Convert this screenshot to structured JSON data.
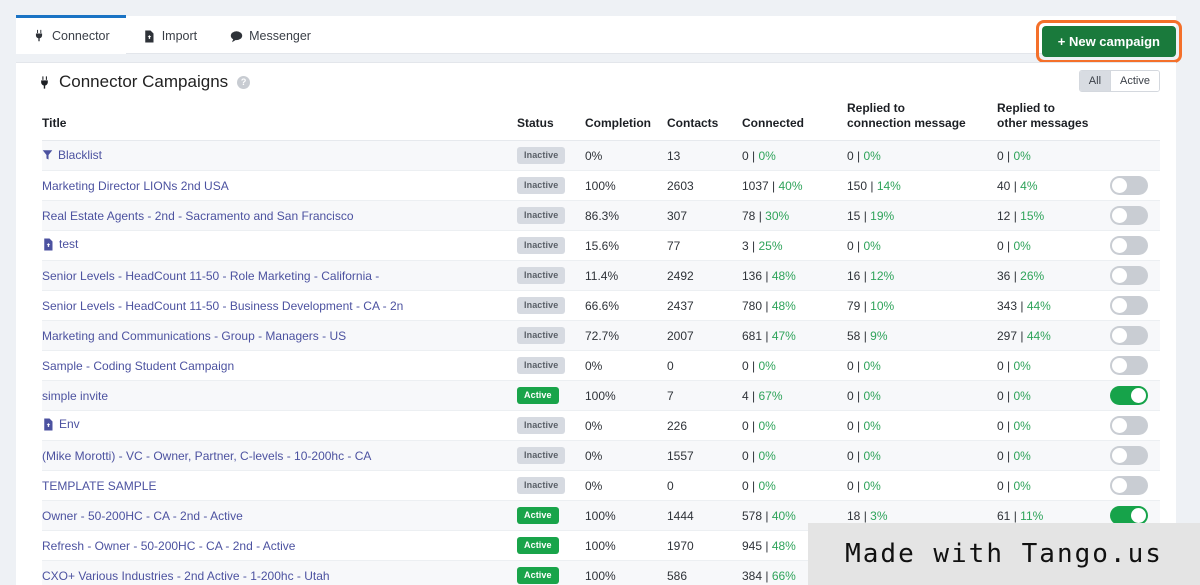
{
  "tabs": [
    {
      "label": "Connector",
      "icon": "plug-icon",
      "active": true
    },
    {
      "label": "Import",
      "icon": "file-import-icon",
      "active": false
    },
    {
      "label": "Messenger",
      "icon": "chat-bubble-icon",
      "active": false
    }
  ],
  "toolbar": {
    "new_campaign_label": "+ New campaign",
    "new_campaign_color": "#1a7a3c",
    "highlight_color": "#f4702a"
  },
  "panel": {
    "title": "Connector Campaigns",
    "title_icon": "plug-icon",
    "help_icon": "question-mark-icon",
    "help_glyph": "?",
    "filters": [
      {
        "label": "All",
        "selected": true
      },
      {
        "label": "Active",
        "selected": false
      }
    ]
  },
  "table": {
    "columns": [
      {
        "key": "title",
        "label": "Title"
      },
      {
        "key": "status",
        "label": "Status"
      },
      {
        "key": "completion",
        "label": "Completion"
      },
      {
        "key": "contacts",
        "label": "Contacts"
      },
      {
        "key": "connected",
        "label": "Connected"
      },
      {
        "key": "replied_connection",
        "label": "Replied to\nconnection message",
        "line1": "Replied to",
        "line2": "connection message"
      },
      {
        "key": "replied_other",
        "label": "Replied to\nother messages",
        "line1": "Replied to",
        "line2": "other messages"
      },
      {
        "key": "toggle",
        "label": ""
      }
    ],
    "rows": [
      {
        "title": "Blacklist",
        "icon": "funnel-icon",
        "status": "Inactive",
        "completion": "0%",
        "contacts": "13",
        "connected_n": "0",
        "connected_pct": "0%",
        "rcm_n": "0",
        "rcm_pct": "0%",
        "rom_n": "0",
        "rom_pct": "0%",
        "toggle": "none"
      },
      {
        "title": "Marketing Director LIONs 2nd USA",
        "icon": "",
        "status": "Inactive",
        "completion": "100%",
        "contacts": "2603",
        "connected_n": "1037",
        "connected_pct": "40%",
        "rcm_n": "150",
        "rcm_pct": "14%",
        "rom_n": "40",
        "rom_pct": "4%",
        "toggle": "off"
      },
      {
        "title": "Real Estate Agents - 2nd - Sacramento and San Francisco",
        "icon": "",
        "status": "Inactive",
        "completion": "86.3%",
        "contacts": "307",
        "connected_n": "78",
        "connected_pct": "30%",
        "rcm_n": "15",
        "rcm_pct": "19%",
        "rom_n": "12",
        "rom_pct": "15%",
        "toggle": "off"
      },
      {
        "title": "test",
        "icon": "file-import-icon",
        "status": "Inactive",
        "completion": "15.6%",
        "contacts": "77",
        "connected_n": "3",
        "connected_pct": "25%",
        "rcm_n": "0",
        "rcm_pct": "0%",
        "rom_n": "0",
        "rom_pct": "0%",
        "toggle": "off"
      },
      {
        "title": "Senior Levels - HeadCount 11-50 - Role Marketing - California -",
        "icon": "",
        "status": "Inactive",
        "completion": "11.4%",
        "contacts": "2492",
        "connected_n": "136",
        "connected_pct": "48%",
        "rcm_n": "16",
        "rcm_pct": "12%",
        "rom_n": "36",
        "rom_pct": "26%",
        "toggle": "off"
      },
      {
        "title": "Senior Levels - HeadCount 11-50 - Business Development - CA - 2n",
        "icon": "",
        "status": "Inactive",
        "completion": "66.6%",
        "contacts": "2437",
        "connected_n": "780",
        "connected_pct": "48%",
        "rcm_n": "79",
        "rcm_pct": "10%",
        "rom_n": "343",
        "rom_pct": "44%",
        "toggle": "off"
      },
      {
        "title": "Marketing and Communications - Group - Managers - US",
        "icon": "",
        "status": "Inactive",
        "completion": "72.7%",
        "contacts": "2007",
        "connected_n": "681",
        "connected_pct": "47%",
        "rcm_n": "58",
        "rcm_pct": "9%",
        "rom_n": "297",
        "rom_pct": "44%",
        "toggle": "off"
      },
      {
        "title": "Sample - Coding Student Campaign",
        "icon": "",
        "status": "Inactive",
        "completion": "0%",
        "contacts": "0",
        "connected_n": "0",
        "connected_pct": "0%",
        "rcm_n": "0",
        "rcm_pct": "0%",
        "rom_n": "0",
        "rom_pct": "0%",
        "toggle": "off"
      },
      {
        "title": "simple invite",
        "icon": "",
        "status": "Active",
        "completion": "100%",
        "contacts": "7",
        "connected_n": "4",
        "connected_pct": "67%",
        "rcm_n": "0",
        "rcm_pct": "0%",
        "rom_n": "0",
        "rom_pct": "0%",
        "toggle": "on"
      },
      {
        "title": "Env",
        "icon": "file-import-icon",
        "status": "Inactive",
        "completion": "0%",
        "contacts": "226",
        "connected_n": "0",
        "connected_pct": "0%",
        "rcm_n": "0",
        "rcm_pct": "0%",
        "rom_n": "0",
        "rom_pct": "0%",
        "toggle": "off"
      },
      {
        "title": "(Mike Morotti) - VC - Owner, Partner, C-levels - 10-200hc - CA",
        "icon": "",
        "status": "Inactive",
        "completion": "0%",
        "contacts": "1557",
        "connected_n": "0",
        "connected_pct": "0%",
        "rcm_n": "0",
        "rcm_pct": "0%",
        "rom_n": "0",
        "rom_pct": "0%",
        "toggle": "off"
      },
      {
        "title": "TEMPLATE SAMPLE",
        "icon": "",
        "status": "Inactive",
        "completion": "0%",
        "contacts": "0",
        "connected_n": "0",
        "connected_pct": "0%",
        "rcm_n": "0",
        "rcm_pct": "0%",
        "rom_n": "0",
        "rom_pct": "0%",
        "toggle": "off"
      },
      {
        "title": "Owner - 50-200HC - CA - 2nd - Active",
        "icon": "",
        "status": "Active",
        "completion": "100%",
        "contacts": "1444",
        "connected_n": "578",
        "connected_pct": "40%",
        "rcm_n": "18",
        "rcm_pct": "3%",
        "rom_n": "61",
        "rom_pct": "11%",
        "toggle": "on"
      },
      {
        "title": "Refresh - Owner - 50-200HC - CA - 2nd - Active",
        "icon": "",
        "status": "Active",
        "completion": "100%",
        "contacts": "1970",
        "connected_n": "945",
        "connected_pct": "48%",
        "rcm_n": "",
        "rcm_pct": "",
        "rom_n": "",
        "rom_pct": "",
        "toggle": "on"
      },
      {
        "title": "CXO+ Various Industries - 2nd Active - 1-200hc - Utah",
        "icon": "",
        "status": "Active",
        "completion": "100%",
        "contacts": "586",
        "connected_n": "384",
        "connected_pct": "66%",
        "rcm_n": "",
        "rcm_pct": "",
        "rom_n": "",
        "rom_pct": "",
        "toggle": "on"
      }
    ]
  },
  "watermark": {
    "text": "Made with Tango.us"
  }
}
